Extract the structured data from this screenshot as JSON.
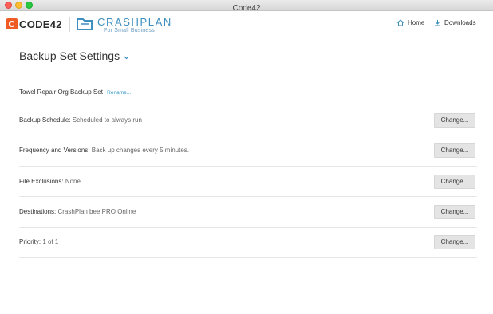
{
  "window": {
    "title": "Code42"
  },
  "header": {
    "code42_logo_text": "CODE42",
    "crashplan_name": "CRASHPLAN",
    "crashplan_sub": "For Small Business",
    "nav": {
      "home_label": "Home",
      "downloads_label": "Downloads"
    },
    "colors": {
      "code42_orange": "#ef5b25",
      "crashplan_blue": "#3d8fbf",
      "link_blue": "#2d97c9"
    }
  },
  "page": {
    "title": "Backup Set Settings",
    "backup_set": {
      "name": "Towel Repair Org Backup Set",
      "rename_label": "Rename..."
    },
    "settings": [
      {
        "label": "Backup Schedule:",
        "value": "Scheduled to always run",
        "button": "Change..."
      },
      {
        "label": "Frequency and Versions:",
        "value": "Back up changes every 5 minutes.",
        "button": "Change..."
      },
      {
        "label": "File Exclusions:",
        "value": "None",
        "button": "Change..."
      },
      {
        "label": "Destinations:",
        "value": "CrashPlan bee PRO Online",
        "button": "Change..."
      },
      {
        "label": "Priority:",
        "value": "1 of 1",
        "button": "Change..."
      }
    ]
  }
}
